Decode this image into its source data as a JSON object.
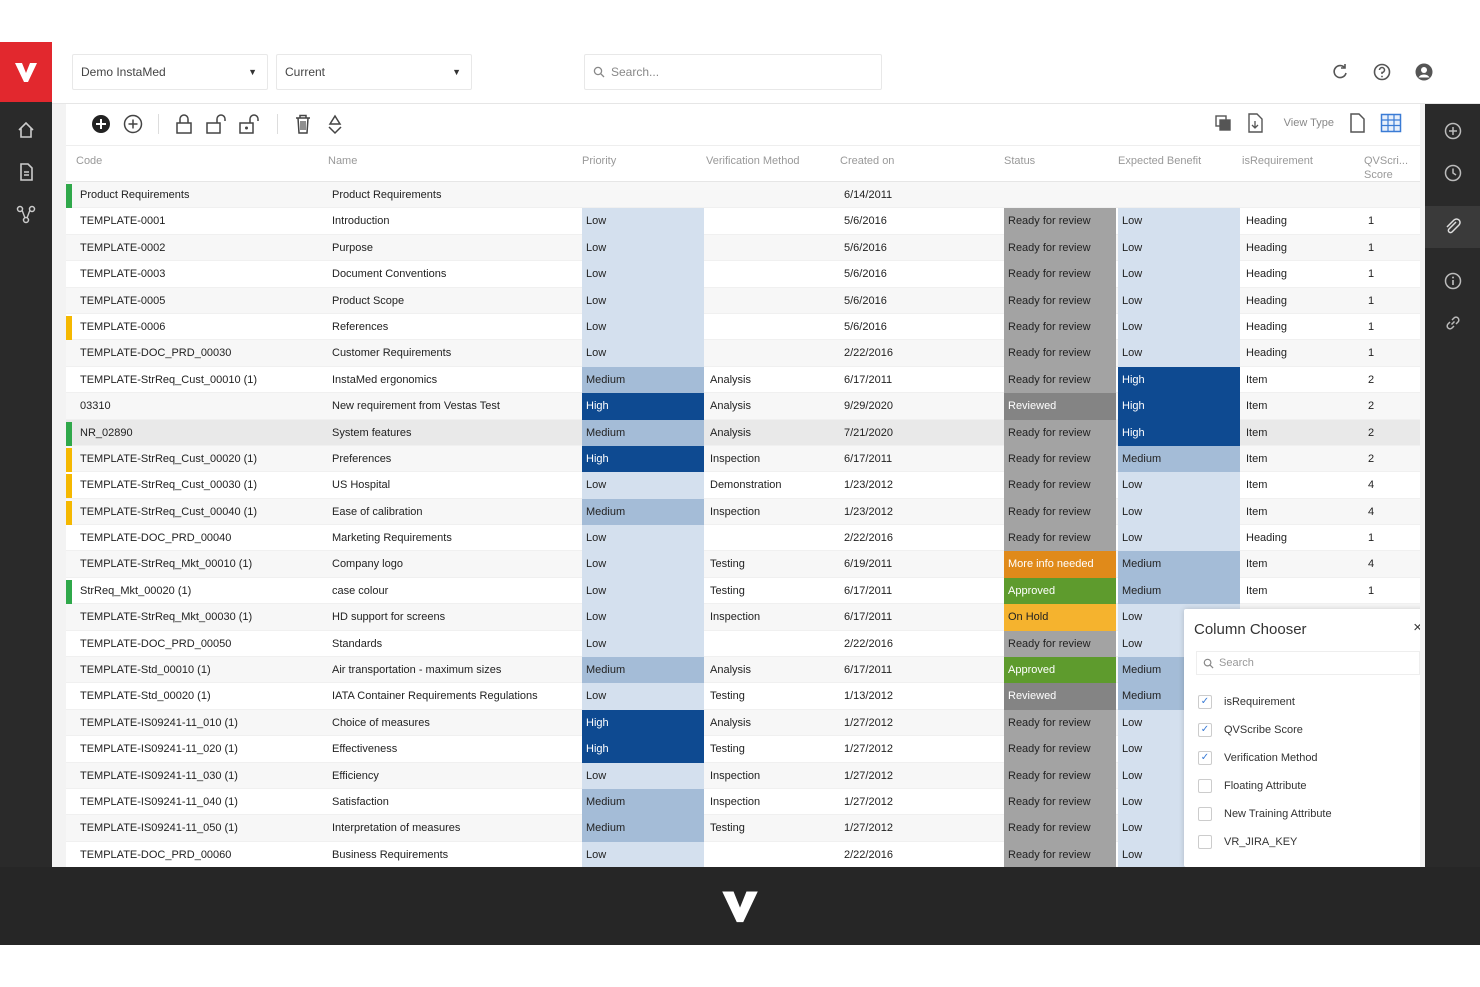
{
  "project_select": {
    "value": "Demo InstaMed"
  },
  "version_select": {
    "value": "Current"
  },
  "search": {
    "placeholder": "Search..."
  },
  "toolbar": {
    "view_type_label": "View Type"
  },
  "columns": [
    "Code",
    "Name",
    "Priority",
    "Verification Method",
    "Created on",
    "Status",
    "Expected Benefit",
    "isRequirement",
    "QVScri...\nScore"
  ],
  "colors": {
    "brand": "#e2282e",
    "priority_low": "#d4e0ee",
    "priority_medium": "#a4bcd7",
    "priority_high": "#0e4a91",
    "status_ready": "#a3a3a3",
    "status_reviewed": "#848484",
    "status_more_info": "#e08a1a",
    "status_approved": "#5e9b2d",
    "status_on_hold": "#f5b32e",
    "bar_green": "#2fa84a",
    "bar_yellow": "#f5b800"
  },
  "rows": [
    {
      "bar": "green",
      "code": "Product Requirements",
      "name": "Product Requirements",
      "priority": "",
      "method": "",
      "created": "6/14/2011",
      "status": "",
      "benefit": "",
      "isreq": "",
      "score": ""
    },
    {
      "bar": "",
      "code": "TEMPLATE-0001",
      "name": "Introduction",
      "priority": "Low",
      "method": "",
      "created": "5/6/2016",
      "status": "Ready for review",
      "benefit": "Low",
      "isreq": "Heading",
      "score": "1"
    },
    {
      "bar": "",
      "code": "TEMPLATE-0002",
      "name": "Purpose",
      "priority": "Low",
      "method": "",
      "created": "5/6/2016",
      "status": "Ready for review",
      "benefit": "Low",
      "isreq": "Heading",
      "score": "1"
    },
    {
      "bar": "",
      "code": "TEMPLATE-0003",
      "name": "Document Conventions",
      "priority": "Low",
      "method": "",
      "created": "5/6/2016",
      "status": "Ready for review",
      "benefit": "Low",
      "isreq": "Heading",
      "score": "1"
    },
    {
      "bar": "",
      "code": "TEMPLATE-0005",
      "name": "Product Scope",
      "priority": "Low",
      "method": "",
      "created": "5/6/2016",
      "status": "Ready for review",
      "benefit": "Low",
      "isreq": "Heading",
      "score": "1"
    },
    {
      "bar": "yellow",
      "code": "TEMPLATE-0006",
      "name": "References",
      "priority": "Low",
      "method": "",
      "created": "5/6/2016",
      "status": "Ready for review",
      "benefit": "Low",
      "isreq": "Heading",
      "score": "1"
    },
    {
      "bar": "",
      "code": "TEMPLATE-DOC_PRD_00030",
      "name": "Customer Requirements",
      "priority": "Low",
      "method": "",
      "created": "2/22/2016",
      "status": "Ready for review",
      "benefit": "Low",
      "isreq": "Heading",
      "score": "1"
    },
    {
      "bar": "",
      "code": "TEMPLATE-StrReq_Cust_00010 (1)",
      "name": "InstaMed ergonomics",
      "priority": "Medium",
      "method": "Analysis",
      "created": "6/17/2011",
      "status": "Ready for review",
      "benefit": "High",
      "isreq": "Item",
      "score": "2"
    },
    {
      "bar": "",
      "code": "03310",
      "name": "New requirement from Vestas Test",
      "priority": "High",
      "method": "Analysis",
      "created": "9/29/2020",
      "status": "Reviewed",
      "benefit": "High",
      "isreq": "Item",
      "score": "2"
    },
    {
      "bar": "green",
      "code": "NR_02890",
      "name": "System features",
      "priority": "Medium",
      "method": "Analysis",
      "created": "7/21/2020",
      "status": "Ready for review",
      "benefit": "High",
      "isreq": "Item",
      "score": "2",
      "hl": true
    },
    {
      "bar": "yellow",
      "code": "TEMPLATE-StrReq_Cust_00020 (1)",
      "name": "Preferences",
      "priority": "High",
      "method": "Inspection",
      "created": "6/17/2011",
      "status": "Ready for review",
      "benefit": "Medium",
      "isreq": "Item",
      "score": "2"
    },
    {
      "bar": "yellow",
      "code": "TEMPLATE-StrReq_Cust_00030 (1)",
      "name": "US Hospital",
      "priority": "Low",
      "method": "Demonstration",
      "created": "1/23/2012",
      "status": "Ready for review",
      "benefit": "Low",
      "isreq": "Item",
      "score": "4"
    },
    {
      "bar": "yellow",
      "code": "TEMPLATE-StrReq_Cust_00040 (1)",
      "name": "Ease of calibration",
      "priority": "Medium",
      "method": "Inspection",
      "created": "1/23/2012",
      "status": "Ready for review",
      "benefit": "Low",
      "isreq": "Item",
      "score": "4"
    },
    {
      "bar": "",
      "code": "TEMPLATE-DOC_PRD_00040",
      "name": "Marketing Requirements",
      "priority": "Low",
      "method": "",
      "created": "2/22/2016",
      "status": "Ready for review",
      "benefit": "Low",
      "isreq": "Heading",
      "score": "1"
    },
    {
      "bar": "",
      "code": "TEMPLATE-StrReq_Mkt_00010 (1)",
      "name": "Company logo",
      "priority": "Low",
      "method": "Testing",
      "created": "6/19/2011",
      "status": "More info needed",
      "benefit": "Medium",
      "isreq": "Item",
      "score": "4"
    },
    {
      "bar": "green",
      "code": "StrReq_Mkt_00020 (1)",
      "name": "case colour",
      "priority": "Low",
      "method": "Testing",
      "created": "6/17/2011",
      "status": "Approved",
      "benefit": "Medium",
      "isreq": "Item",
      "score": "1"
    },
    {
      "bar": "",
      "code": "TEMPLATE-StrReq_Mkt_00030 (1)",
      "name": "HD support for screens",
      "priority": "Low",
      "method": "Inspection",
      "created": "6/17/2011",
      "status": "On Hold",
      "benefit": "Low",
      "isreq": "",
      "score": ""
    },
    {
      "bar": "",
      "code": "TEMPLATE-DOC_PRD_00050",
      "name": "Standards",
      "priority": "Low",
      "method": "",
      "created": "2/22/2016",
      "status": "Ready for review",
      "benefit": "Low",
      "isreq": "",
      "score": ""
    },
    {
      "bar": "",
      "code": "TEMPLATE-Std_00010 (1)",
      "name": "Air transportation - maximum sizes",
      "priority": "Medium",
      "method": "Analysis",
      "created": "6/17/2011",
      "status": "Approved",
      "benefit": "Medium",
      "isreq": "",
      "score": ""
    },
    {
      "bar": "",
      "code": "TEMPLATE-Std_00020 (1)",
      "name": "IATA Container Requirements Regulations",
      "priority": "Low",
      "method": "Testing",
      "created": "1/13/2012",
      "status": "Reviewed",
      "benefit": "Medium",
      "isreq": "",
      "score": ""
    },
    {
      "bar": "",
      "code": "TEMPLATE-IS09241-11_010 (1)",
      "name": "Choice of measures",
      "priority": "High",
      "method": "Analysis",
      "created": "1/27/2012",
      "status": "Ready for review",
      "benefit": "Low",
      "isreq": "",
      "score": ""
    },
    {
      "bar": "",
      "code": "TEMPLATE-IS09241-11_020 (1)",
      "name": "Effectiveness",
      "priority": "High",
      "method": "Testing",
      "created": "1/27/2012",
      "status": "Ready for review",
      "benefit": "Low",
      "isreq": "",
      "score": ""
    },
    {
      "bar": "",
      "code": "TEMPLATE-IS09241-11_030 (1)",
      "name": "Efficiency",
      "priority": "Low",
      "method": "Inspection",
      "created": "1/27/2012",
      "status": "Ready for review",
      "benefit": "Low",
      "isreq": "",
      "score": ""
    },
    {
      "bar": "",
      "code": "TEMPLATE-IS09241-11_040 (1)",
      "name": "Satisfaction",
      "priority": "Medium",
      "method": "Inspection",
      "created": "1/27/2012",
      "status": "Ready for review",
      "benefit": "Low",
      "isreq": "",
      "score": ""
    },
    {
      "bar": "",
      "code": "TEMPLATE-IS09241-11_050 (1)",
      "name": "Interpretation of measures",
      "priority": "Medium",
      "method": "Testing",
      "created": "1/27/2012",
      "status": "Ready for review",
      "benefit": "Low",
      "isreq": "",
      "score": ""
    },
    {
      "bar": "",
      "code": "TEMPLATE-DOC_PRD_00060",
      "name": "Business Requirements",
      "priority": "Low",
      "method": "",
      "created": "2/22/2016",
      "status": "Ready for review",
      "benefit": "Low",
      "isreq": "",
      "score": ""
    }
  ],
  "column_chooser": {
    "title": "Column Chooser",
    "close": "×",
    "search_placeholder": "Search",
    "options": [
      {
        "label": "isRequirement",
        "checked": true
      },
      {
        "label": "QVScribe Score",
        "checked": true
      },
      {
        "label": "Verification Method",
        "checked": true
      },
      {
        "label": "Floating Attribute",
        "checked": false
      },
      {
        "label": "New Training Attribute",
        "checked": false
      },
      {
        "label": "VR_JIRA_KEY",
        "checked": false
      }
    ]
  }
}
